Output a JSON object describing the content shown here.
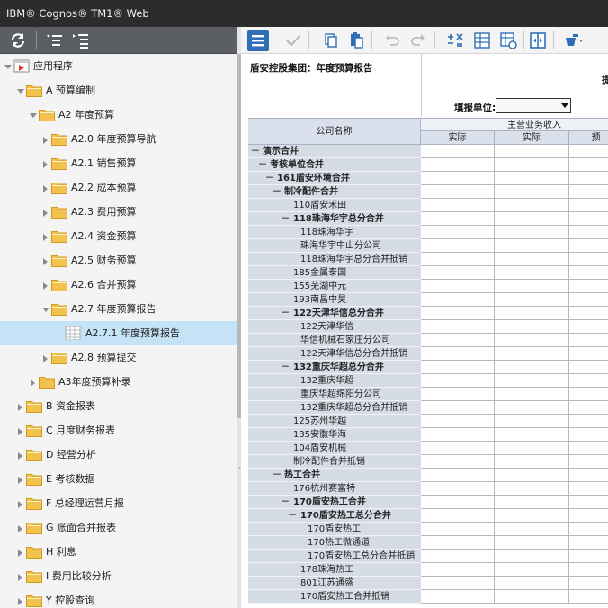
{
  "window": {
    "title": "IBM® Cognos® TM1® Web"
  },
  "left_toolbar": {
    "buttons": [
      "refresh-icon",
      "tree-collapse-icon",
      "tree-expand-icon"
    ]
  },
  "right_toolbar": {
    "buttons": [
      "menu-icon",
      "commit-check-icon",
      "copy-icon",
      "paste-icon",
      "undo-icon",
      "redo-icon",
      "calculate-icon",
      "spreadsheet-icon",
      "view-grid-icon",
      "fit-columns-icon",
      "paint-bucket-icon"
    ]
  },
  "tree": {
    "root": "应用程序",
    "items": [
      {
        "label": "A 预算编制",
        "level": 1,
        "expanded": true
      },
      {
        "label": "A2 年度预算",
        "level": 2,
        "expanded": true
      },
      {
        "label": "A2.0 年度预算导航",
        "level": 3,
        "expanded": false
      },
      {
        "label": "A2.1 销售预算",
        "level": 3,
        "expanded": false
      },
      {
        "label": "A2.2 成本预算",
        "level": 3,
        "expanded": false
      },
      {
        "label": "A2.3 费用预算",
        "level": 3,
        "expanded": false
      },
      {
        "label": "A2.4 资金预算",
        "level": 3,
        "expanded": false
      },
      {
        "label": "A2.5 财务预算",
        "level": 3,
        "expanded": false
      },
      {
        "label": "A2.6 合并预算",
        "level": 3,
        "expanded": false
      },
      {
        "label": "A2.7 年度预算报告",
        "level": 3,
        "expanded": true
      },
      {
        "label": "A2.7.1 年度预算报告",
        "level": 4,
        "selected": true,
        "type": "report"
      },
      {
        "label": "A2.8 预算提交",
        "level": 3,
        "expanded": false
      },
      {
        "label": "A3年度预算补录",
        "level": 2,
        "expanded": false
      },
      {
        "label": "B 资金报表",
        "level": 1,
        "expanded": false
      },
      {
        "label": "C 月度财务报表",
        "level": 1,
        "expanded": false
      },
      {
        "label": "D 经营分析",
        "level": 1,
        "expanded": false
      },
      {
        "label": "E 考核数据",
        "level": 1,
        "expanded": false
      },
      {
        "label": "F 总经理运营月报",
        "level": 1,
        "expanded": false
      },
      {
        "label": "G 账面合并报表",
        "level": 1,
        "expanded": false
      },
      {
        "label": "H 利息",
        "level": 1,
        "expanded": false
      },
      {
        "label": "I 费用比较分析",
        "level": 1,
        "expanded": false
      },
      {
        "label": "Y 控股查询",
        "level": 1,
        "expanded": false
      }
    ]
  },
  "report": {
    "title": "盾安控股集团：年度预算报告",
    "right_tip": "提",
    "fill_unit_label": "填报单位:",
    "fill_unit_value": "",
    "company_header": "公司名称",
    "group_header": "主营业务收入",
    "sub_headers": [
      "实际",
      "实际",
      "预"
    ],
    "rows": [
      {
        "label": "演示合并",
        "indent": 0,
        "bold": true,
        "collapse": "－"
      },
      {
        "label": "考核单位合并",
        "indent": 1,
        "bold": true,
        "collapse": "－"
      },
      {
        "label": "161盾安环境合并",
        "indent": 2,
        "bold": true,
        "collapse": "－"
      },
      {
        "label": "制冷配件合并",
        "indent": 3,
        "bold": true,
        "collapse": "－"
      },
      {
        "label": "110盾安禾田",
        "indent": 4,
        "bold": false,
        "collapse": ""
      },
      {
        "label": "118珠海华宇总分合并",
        "indent": 4,
        "bold": true,
        "collapse": "－"
      },
      {
        "label": "118珠海华宇",
        "indent": 5,
        "bold": false,
        "collapse": ""
      },
      {
        "label": "珠海华宇中山分公司",
        "indent": 5,
        "bold": false,
        "collapse": ""
      },
      {
        "label": "118珠海华宇总分合并抵销",
        "indent": 5,
        "bold": false,
        "collapse": ""
      },
      {
        "label": "185金属泰国",
        "indent": 4,
        "bold": false,
        "collapse": ""
      },
      {
        "label": "155芜湖中元",
        "indent": 4,
        "bold": false,
        "collapse": ""
      },
      {
        "label": "193南昌中昊",
        "indent": 4,
        "bold": false,
        "collapse": ""
      },
      {
        "label": "122天津华信总分合并",
        "indent": 4,
        "bold": true,
        "collapse": "－"
      },
      {
        "label": "122天津华信",
        "indent": 5,
        "bold": false,
        "collapse": ""
      },
      {
        "label": "华信机械石家庄分公司",
        "indent": 5,
        "bold": false,
        "collapse": ""
      },
      {
        "label": "122天津华信总分合并抵销",
        "indent": 5,
        "bold": false,
        "collapse": ""
      },
      {
        "label": "132重庆华超总分合并",
        "indent": 4,
        "bold": true,
        "collapse": "－"
      },
      {
        "label": "132重庆华超",
        "indent": 5,
        "bold": false,
        "collapse": ""
      },
      {
        "label": "重庆华超绵阳分公司",
        "indent": 5,
        "bold": false,
        "collapse": ""
      },
      {
        "label": "132重庆华超总分合并抵销",
        "indent": 5,
        "bold": false,
        "collapse": ""
      },
      {
        "label": "125苏州华越",
        "indent": 4,
        "bold": false,
        "collapse": ""
      },
      {
        "label": "135安徽华海",
        "indent": 4,
        "bold": false,
        "collapse": ""
      },
      {
        "label": "104盾安机械",
        "indent": 4,
        "bold": false,
        "collapse": ""
      },
      {
        "label": "制冷配件合并抵销",
        "indent": 4,
        "bold": false,
        "collapse": ""
      },
      {
        "label": "热工合并",
        "indent": 3,
        "bold": true,
        "collapse": "－"
      },
      {
        "label": "176杭州赛富特",
        "indent": 4,
        "bold": false,
        "collapse": ""
      },
      {
        "label": "170盾安热工合并",
        "indent": 4,
        "bold": true,
        "collapse": "－"
      },
      {
        "label": "170盾安热工总分合并",
        "indent": 5,
        "bold": true,
        "collapse": "－"
      },
      {
        "label": "170盾安热工",
        "indent": 6,
        "bold": false,
        "collapse": ""
      },
      {
        "label": "170热工微通道",
        "indent": 6,
        "bold": false,
        "collapse": ""
      },
      {
        "label": "170盾安热工总分合并抵销",
        "indent": 6,
        "bold": false,
        "collapse": ""
      },
      {
        "label": "178珠海热工",
        "indent": 5,
        "bold": false,
        "collapse": ""
      },
      {
        "label": "801江苏通盛",
        "indent": 5,
        "bold": false,
        "collapse": ""
      },
      {
        "label": "170盾安热工合并抵销",
        "indent": 5,
        "bold": false,
        "collapse": ""
      }
    ]
  },
  "colors": {
    "titlebar": "#2c2c2c",
    "left_toolbar": "#5b5f63",
    "tree_bg": "#f4f4f4",
    "selected_row": "#c5e3f6",
    "folder": "#f2c14e",
    "header_bg": "#dbe1ec",
    "row_header_bg": "#d6dce6",
    "accent": "#2f6fb5"
  }
}
